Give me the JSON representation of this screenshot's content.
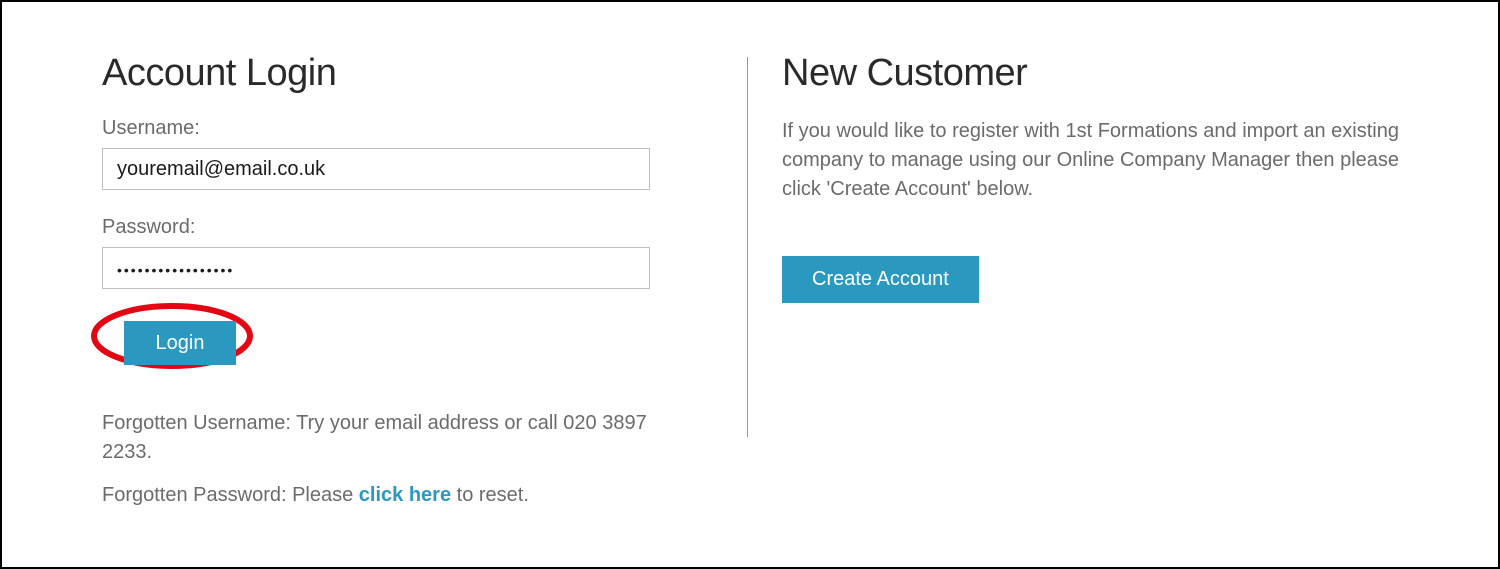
{
  "login": {
    "heading": "Account Login",
    "username_label": "Username:",
    "username_value": "youremail@email.co.uk",
    "password_label": "Password:",
    "password_value": "•••••••••••••••••",
    "login_button": "Login",
    "forgot_username": "Forgotten Username: Try your email address or call 020 3897 2233.",
    "forgot_password_prefix": "Forgotten Password: Please ",
    "forgot_password_link": "click here",
    "forgot_password_suffix": " to reset."
  },
  "new_customer": {
    "heading": "New Customer",
    "description": "If you would like to register with 1st Formations and import an existing company to manage using our Online Company Manager then please click 'Create Account' below.",
    "create_button": "Create Account"
  },
  "colors": {
    "accent": "#2b98c0",
    "highlight_ring": "#e30613"
  }
}
